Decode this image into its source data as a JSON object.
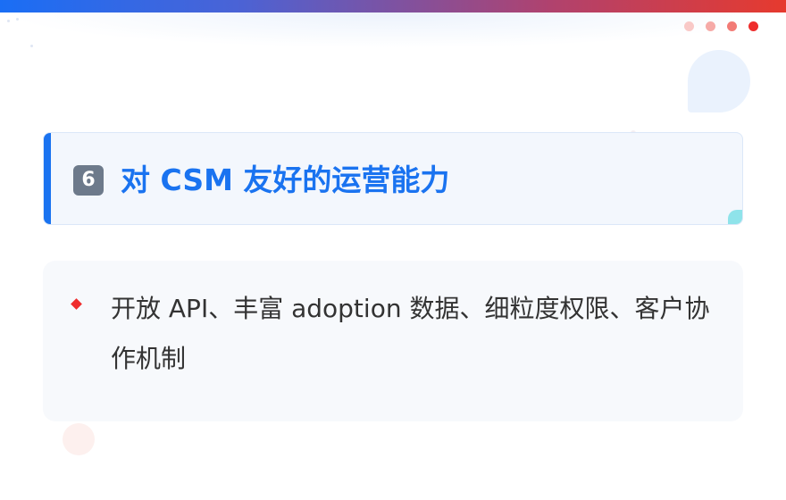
{
  "title": {
    "number_badge": "6",
    "text": "对 CSM 友好的运营能力"
  },
  "content": {
    "bullet_text": "开放 API、丰富 adoption 数据、细粒度权限、客户协作机制"
  },
  "colors": {
    "accent_blue": "#1a73f0",
    "bullet_red": "#ef2d2d",
    "dots": [
      "#f9c9c7",
      "#f6aaa7",
      "#f27b76",
      "#ee2d2d"
    ]
  },
  "icons": {
    "number_badge": "keycap-6-icon",
    "bullet": "diamond-bullet-icon"
  }
}
